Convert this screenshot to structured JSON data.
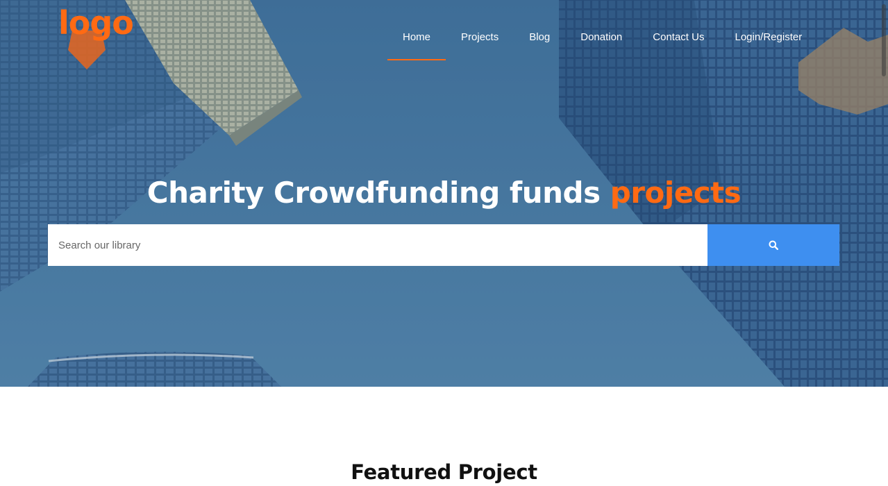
{
  "header": {
    "logo_text": "logo",
    "nav": [
      {
        "label": "Home",
        "active": true
      },
      {
        "label": "Projects",
        "active": false
      },
      {
        "label": "Blog",
        "active": false
      },
      {
        "label": "Donation",
        "active": false
      },
      {
        "label": "Contact Us",
        "active": false
      },
      {
        "label": "Login/Register",
        "active": false
      }
    ]
  },
  "hero": {
    "headline_main": "Charity Crowdfunding funds ",
    "headline_accent": "projects"
  },
  "search": {
    "placeholder": "Search our library",
    "button_icon": "search-icon"
  },
  "featured": {
    "title": "Featured Project"
  },
  "colors": {
    "accent": "#ff6a13",
    "search_button": "#3e8ff0",
    "hero_sky": "#4f7fa3"
  }
}
